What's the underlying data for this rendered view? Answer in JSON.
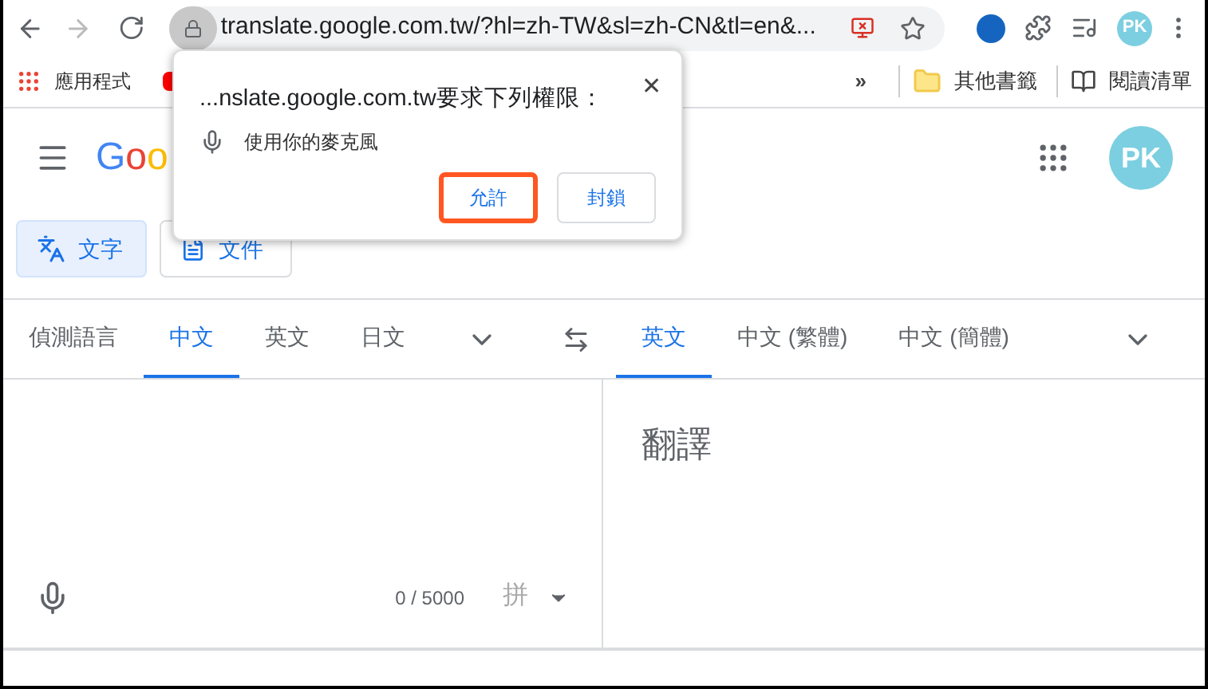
{
  "browser": {
    "url": "translate.google.com.tw/?hl=zh-TW&sl=zh-CN&tl=en&...",
    "avatar": "PK"
  },
  "bookmarks": {
    "left": [
      {
        "label": "應用程式",
        "kind": "apps"
      },
      {
        "kind": "red"
      }
    ],
    "overflow": "»",
    "right": [
      {
        "label": "其他書籤",
        "kind": "folder"
      },
      {
        "label": "閱讀清單",
        "kind": "reading"
      }
    ]
  },
  "header": {
    "logo": "Goo",
    "avatar": "PK"
  },
  "modes": [
    {
      "label": "文字",
      "selected": true,
      "kind": "text"
    },
    {
      "label": "文件",
      "selected": false,
      "kind": "doc"
    }
  ],
  "source_languages": [
    {
      "label": "偵測語言",
      "selected": false
    },
    {
      "label": "中文",
      "selected": true
    },
    {
      "label": "英文",
      "selected": false
    },
    {
      "label": "日文",
      "selected": false
    }
  ],
  "target_languages": [
    {
      "label": "英文",
      "selected": true
    },
    {
      "label": "中文 (繁體)",
      "selected": false
    },
    {
      "label": "中文 (簡體)",
      "selected": false
    }
  ],
  "source_panel": {
    "count": "0 / 5000",
    "input_method": "拼"
  },
  "target_panel": {
    "placeholder": "翻譯"
  },
  "permission_popup": {
    "title": "...nslate.google.com.tw要求下列權限：",
    "close": "✕",
    "permission": "使用你的麥克風",
    "buttons": [
      {
        "label": "允許",
        "focused": true
      },
      {
        "label": "封鎖",
        "focused": false
      }
    ]
  }
}
